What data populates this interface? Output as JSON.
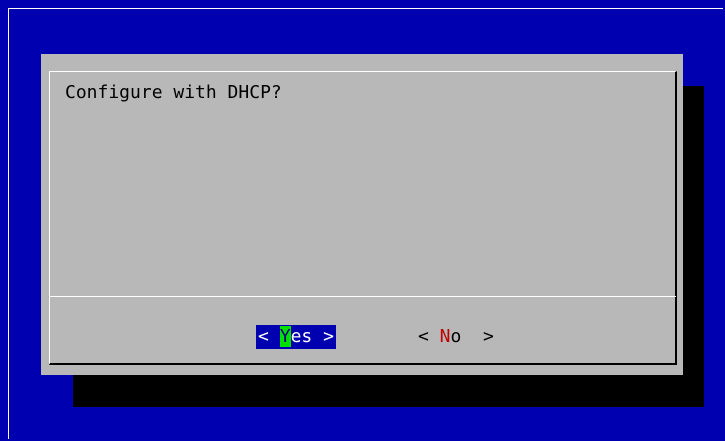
{
  "dialog": {
    "prompt": "Configure with DHCP?",
    "buttons": {
      "yes": {
        "open": "< ",
        "hotkey": "Y",
        "rest": "es",
        "close": " >"
      },
      "no": {
        "open": "< ",
        "hotkey": "N",
        "rest": "o",
        "close": "  >"
      }
    }
  },
  "colors": {
    "background": "#0000b0",
    "dialog": "#b8b8b8",
    "shadow": "#000000",
    "selected_button": "#0000b0",
    "hotkey_selected_bg": "#00e000",
    "hotkey_unselected": "#c00000"
  }
}
